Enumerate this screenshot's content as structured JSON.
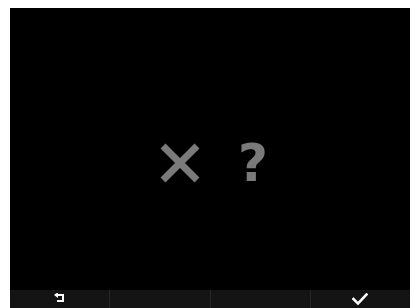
{
  "screen": {
    "status_glyph": {
      "name": "unknown-error",
      "icon_cross": "x-icon",
      "text": "?",
      "color": "#7a7a7a"
    }
  },
  "softkeys": [
    {
      "name": "back",
      "icon": "back-arrow-icon",
      "color": "#ffffff"
    },
    {
      "name": "empty",
      "icon": ""
    },
    {
      "name": "empty",
      "icon": ""
    },
    {
      "name": "confirm",
      "icon": "checkmark-icon",
      "color": "#ffffff"
    }
  ],
  "colors": {
    "screen_bg": "#000000",
    "softkey_bar_bg": "#141414",
    "glyph_gray": "#7a7a7a"
  }
}
